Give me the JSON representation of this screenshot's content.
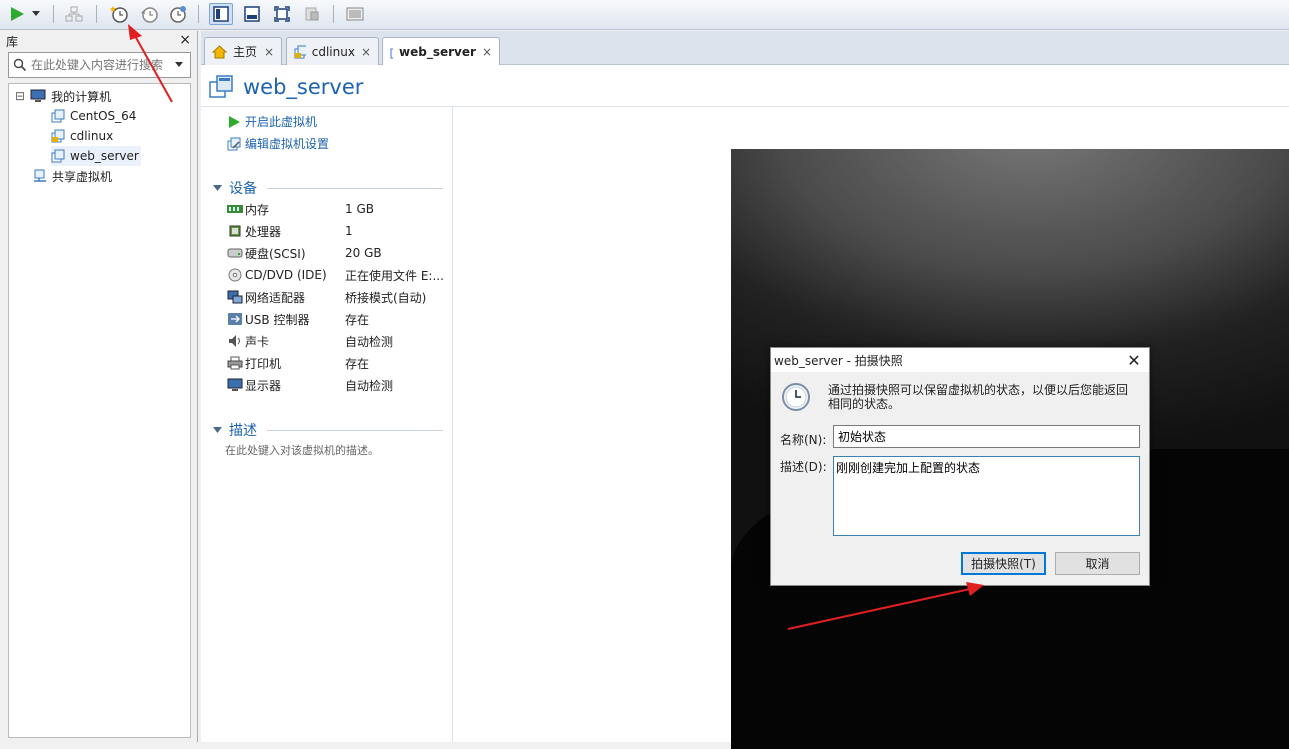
{
  "library": {
    "title": "库",
    "close": "×",
    "search_placeholder": "在此处键入内容进行搜索",
    "tree": [
      {
        "label": "我的计算机"
      },
      {
        "label": "CentOS_64"
      },
      {
        "label": "cdlinux"
      },
      {
        "label": "web_server"
      },
      {
        "label": "共享虚拟机"
      }
    ],
    "expander": "⊟"
  },
  "tabs": [
    {
      "label": "主页",
      "close": "×"
    },
    {
      "label": "cdlinux",
      "close": "×"
    },
    {
      "label": "web_server",
      "close": "×"
    }
  ],
  "vm": {
    "title": "web_server",
    "actions": {
      "power_on": "开启此虚拟机",
      "edit_settings": "编辑虚拟机设置"
    },
    "devices_header": "设备",
    "devices": [
      {
        "name": "内存",
        "value": "1 GB",
        "icon": "memory-icon"
      },
      {
        "name": "处理器",
        "value": "1",
        "icon": "cpu-icon"
      },
      {
        "name": "硬盘(SCSI)",
        "value": "20 GB",
        "icon": "disk-icon"
      },
      {
        "name": "CD/DVD (IDE)",
        "value": "正在使用文件 E:...",
        "icon": "cd-icon"
      },
      {
        "name": "网络适配器",
        "value": "桥接模式(自动)",
        "icon": "network-icon"
      },
      {
        "name": "USB 控制器",
        "value": "存在",
        "icon": "usb-icon"
      },
      {
        "name": "声卡",
        "value": "自动检测",
        "icon": "sound-icon"
      },
      {
        "name": "打印机",
        "value": "存在",
        "icon": "printer-icon"
      },
      {
        "name": "显示器",
        "value": "自动检测",
        "icon": "display-icon"
      }
    ],
    "desc_header": "描述",
    "desc_placeholder": "在此处键入对该虚拟机的描述。"
  },
  "dialog": {
    "title": "web_server - 拍摄快照",
    "close": "✕",
    "message": "通过拍摄快照可以保留虚拟机的状态，以便以后您能返回相同的状态。",
    "name_label": "名称(N):",
    "name_value": "初始状态",
    "desc_label": "描述(D):",
    "desc_value": "刚刚创建完加上配置的状态",
    "ok_label": "拍摄快照(T)",
    "cancel_label": "取消"
  },
  "colors": {
    "accent": "#1d63b1",
    "annotation_arrow": "#e02020",
    "play": "#2eaa2e"
  }
}
